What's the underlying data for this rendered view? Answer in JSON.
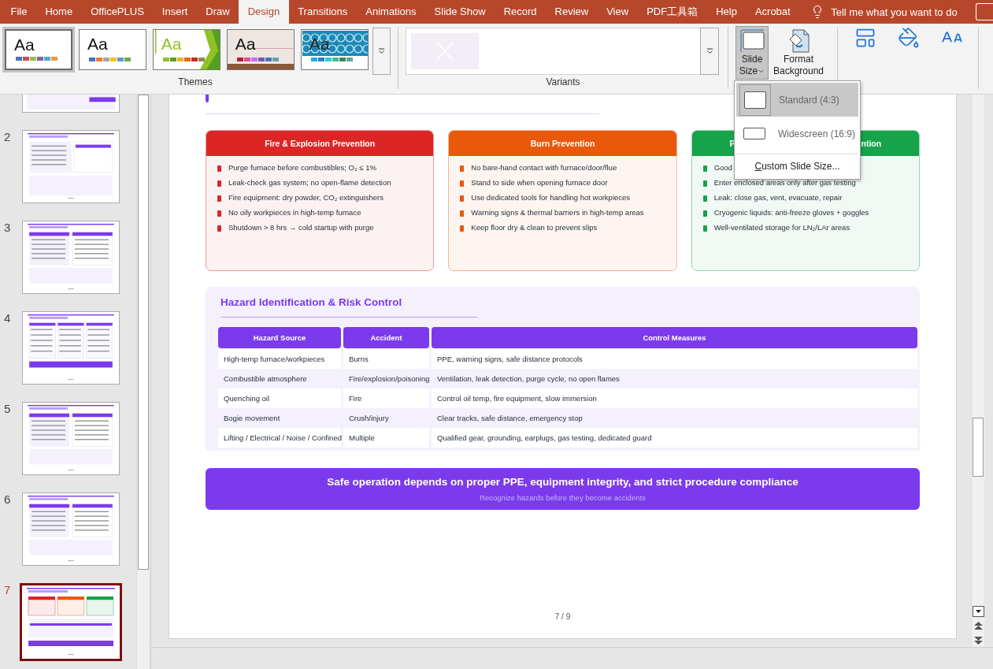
{
  "tabs": [
    {
      "label": "File",
      "selected": false
    },
    {
      "label": "Home",
      "selected": false
    },
    {
      "label": "OfficePLUS",
      "selected": false
    },
    {
      "label": "Insert",
      "selected": false
    },
    {
      "label": "Draw",
      "selected": false
    },
    {
      "label": "Design",
      "selected": true
    },
    {
      "label": "Transitions",
      "selected": false
    },
    {
      "label": "Animations",
      "selected": false
    },
    {
      "label": "Slide Show",
      "selected": false
    },
    {
      "label": "Record",
      "selected": false
    },
    {
      "label": "Review",
      "selected": false
    },
    {
      "label": "View",
      "selected": false
    },
    {
      "label": "PDF工具箱",
      "selected": false
    },
    {
      "label": "Help",
      "selected": false
    },
    {
      "label": "Acrobat",
      "selected": false
    }
  ],
  "tell_me": {
    "label": "Tell me what you want to do"
  },
  "ribbon": {
    "themes": {
      "label": "Themes",
      "items": [
        {
          "kind": "office",
          "sample": "Aa",
          "selected": true
        },
        {
          "kind": "office-classic",
          "sample": "Aa",
          "selected": false
        },
        {
          "kind": "facet",
          "sample": "Aa",
          "selected": false
        },
        {
          "kind": "wood",
          "sample": "Aa",
          "selected": false
        },
        {
          "kind": "pattern",
          "sample": "Aa",
          "selected": false
        }
      ]
    },
    "variants": {
      "label": "Variants"
    },
    "slide_size": {
      "lines": [
        "Slide",
        "Size"
      ],
      "expanded": true
    },
    "format_background": {
      "lines": [
        "Format",
        "Background"
      ]
    }
  },
  "slide_panel": {
    "slides": [
      {
        "number": "2",
        "selected": false
      },
      {
        "number": "3",
        "selected": false
      },
      {
        "number": "4",
        "selected": false
      },
      {
        "number": "5",
        "selected": false
      },
      {
        "number": "6",
        "selected": false
      },
      {
        "number": "7",
        "selected": true
      }
    ]
  },
  "slide": {
    "cards": [
      {
        "title_parts": [
          "Fire & Explosion Prevention"
        ],
        "color": "#dc2626",
        "items": [
          "Purge furnace before combustibles; O₂ ≤ 1%",
          "Leak-check gas system; no open-flame detection",
          "Fire equipment: dry powder, CO₂ extinguishers",
          "No oily workpieces in high-temp furnace",
          "Shutdown > 8 hrs → cold startup with purge"
        ]
      },
      {
        "title_parts": [
          "Burn Prevention"
        ],
        "color": "#ea580c",
        "items": [
          "No bare-hand contact with furnace/door/flue",
          "Stand to side when opening furnace door",
          "Use dedicated tools for handling hot workpieces",
          "Warning signs & thermal barriers in high-temp areas",
          "Keep floor dry & clean to prevent slips"
        ]
      },
      {
        "title_parts": [
          "P",
          "ntion"
        ],
        "color": "#16a34a",
        "items": [
          "Good",
          "Enter enclosed areas only after gas testing",
          "Leak: close gas, vent, evacuate, repair",
          "Cryogenic liquids: anti-freeze gloves + goggles",
          "Well-ventilated storage for LN₂/LAr areas"
        ]
      }
    ],
    "hazard": {
      "title": "Hazard Identification & Risk Control",
      "columns": [
        "Hazard Source",
        "Accident",
        "Control Measures"
      ],
      "rows": [
        [
          "High-temp furnace/workpieces",
          "Burns",
          "PPE, warning signs, safe distance protocols"
        ],
        [
          "Combustible atmosphere",
          "Fire/explosion/poisoning",
          "Ventilation, leak detection, purge cycle, no open flames"
        ],
        [
          "Quenching oil",
          "Fire",
          "Control oil temp, fire equipment, slow immersion"
        ],
        [
          "Bogie movement",
          "Crush/injury",
          "Clear tracks, safe distance, emergency stop"
        ],
        [
          "Lifting / Electrical / Noise / Confined",
          "Multiple",
          "Qualified gear, grounding, earplugs, gas testing, dedicated guard"
        ]
      ]
    },
    "banner": {
      "title": "Safe operation depends on proper PPE, equipment integrity, and strict procedure compliance",
      "subtitle": "Recognize hazards before they become accidents"
    },
    "page_number": "7 / 9"
  },
  "menu": {
    "items": [
      {
        "kind": "standard",
        "label": "Standard (4:3)",
        "selected": true
      },
      {
        "kind": "widescreen",
        "label": "Widescreen (16:9)",
        "selected": false
      },
      {
        "kind": "command",
        "label": "Custom Slide Size...",
        "selected": false
      }
    ]
  }
}
